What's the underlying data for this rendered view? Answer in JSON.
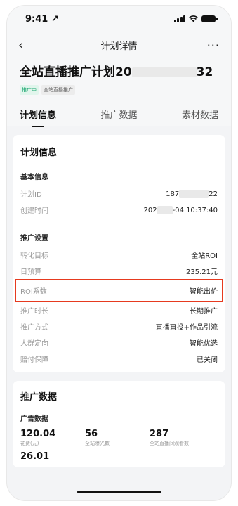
{
  "status_bar": {
    "time": "9:41",
    "location_arrow": "↗"
  },
  "nav": {
    "back": "‹",
    "title": "计划详情",
    "more": "···"
  },
  "plan": {
    "title_prefix": "全站直播推广计划20",
    "title_suffix": "32",
    "tags": [
      "推广中",
      "全站直播推广"
    ]
  },
  "tabs": [
    {
      "label": "计划信息",
      "active": true
    },
    {
      "label": "推广数据",
      "active": false
    },
    {
      "label": "素材数据",
      "active": false
    }
  ],
  "plan_info": {
    "card_title": "计划信息",
    "basic": {
      "section_title": "基本信息",
      "rows": [
        {
          "key": "计划ID",
          "value_prefix": "187",
          "value_suffix": "22"
        },
        {
          "key": "创建时间",
          "value_prefix": "202",
          "value_suffix": "-04 10:37:40"
        }
      ]
    },
    "settings": {
      "section_title": "推广设置",
      "rows": [
        {
          "key": "转化目标",
          "value": "全站ROI"
        },
        {
          "key": "日预算",
          "value": "235.21元"
        },
        {
          "key": "ROI系数",
          "value": "智能出价"
        },
        {
          "key": "推广时长",
          "value": "长期推广"
        },
        {
          "key": "推广方式",
          "value": "直播直投+作品引流"
        },
        {
          "key": "人群定向",
          "value": "智能优选"
        },
        {
          "key": "赔付保障",
          "value": "已关闭"
        }
      ]
    }
  },
  "promo_data": {
    "card_title": "推广数据",
    "section_title": "广告数据",
    "metrics": [
      {
        "value": "120.04",
        "label": "花费(元)"
      },
      {
        "value": "56",
        "label": "全站曝光数"
      },
      {
        "value": "287",
        "label": "全站直播间观看数"
      }
    ],
    "next_value": "26.01"
  },
  "colors": {
    "highlight_border": "#e63a1f",
    "tag_green": "#12a36a"
  }
}
